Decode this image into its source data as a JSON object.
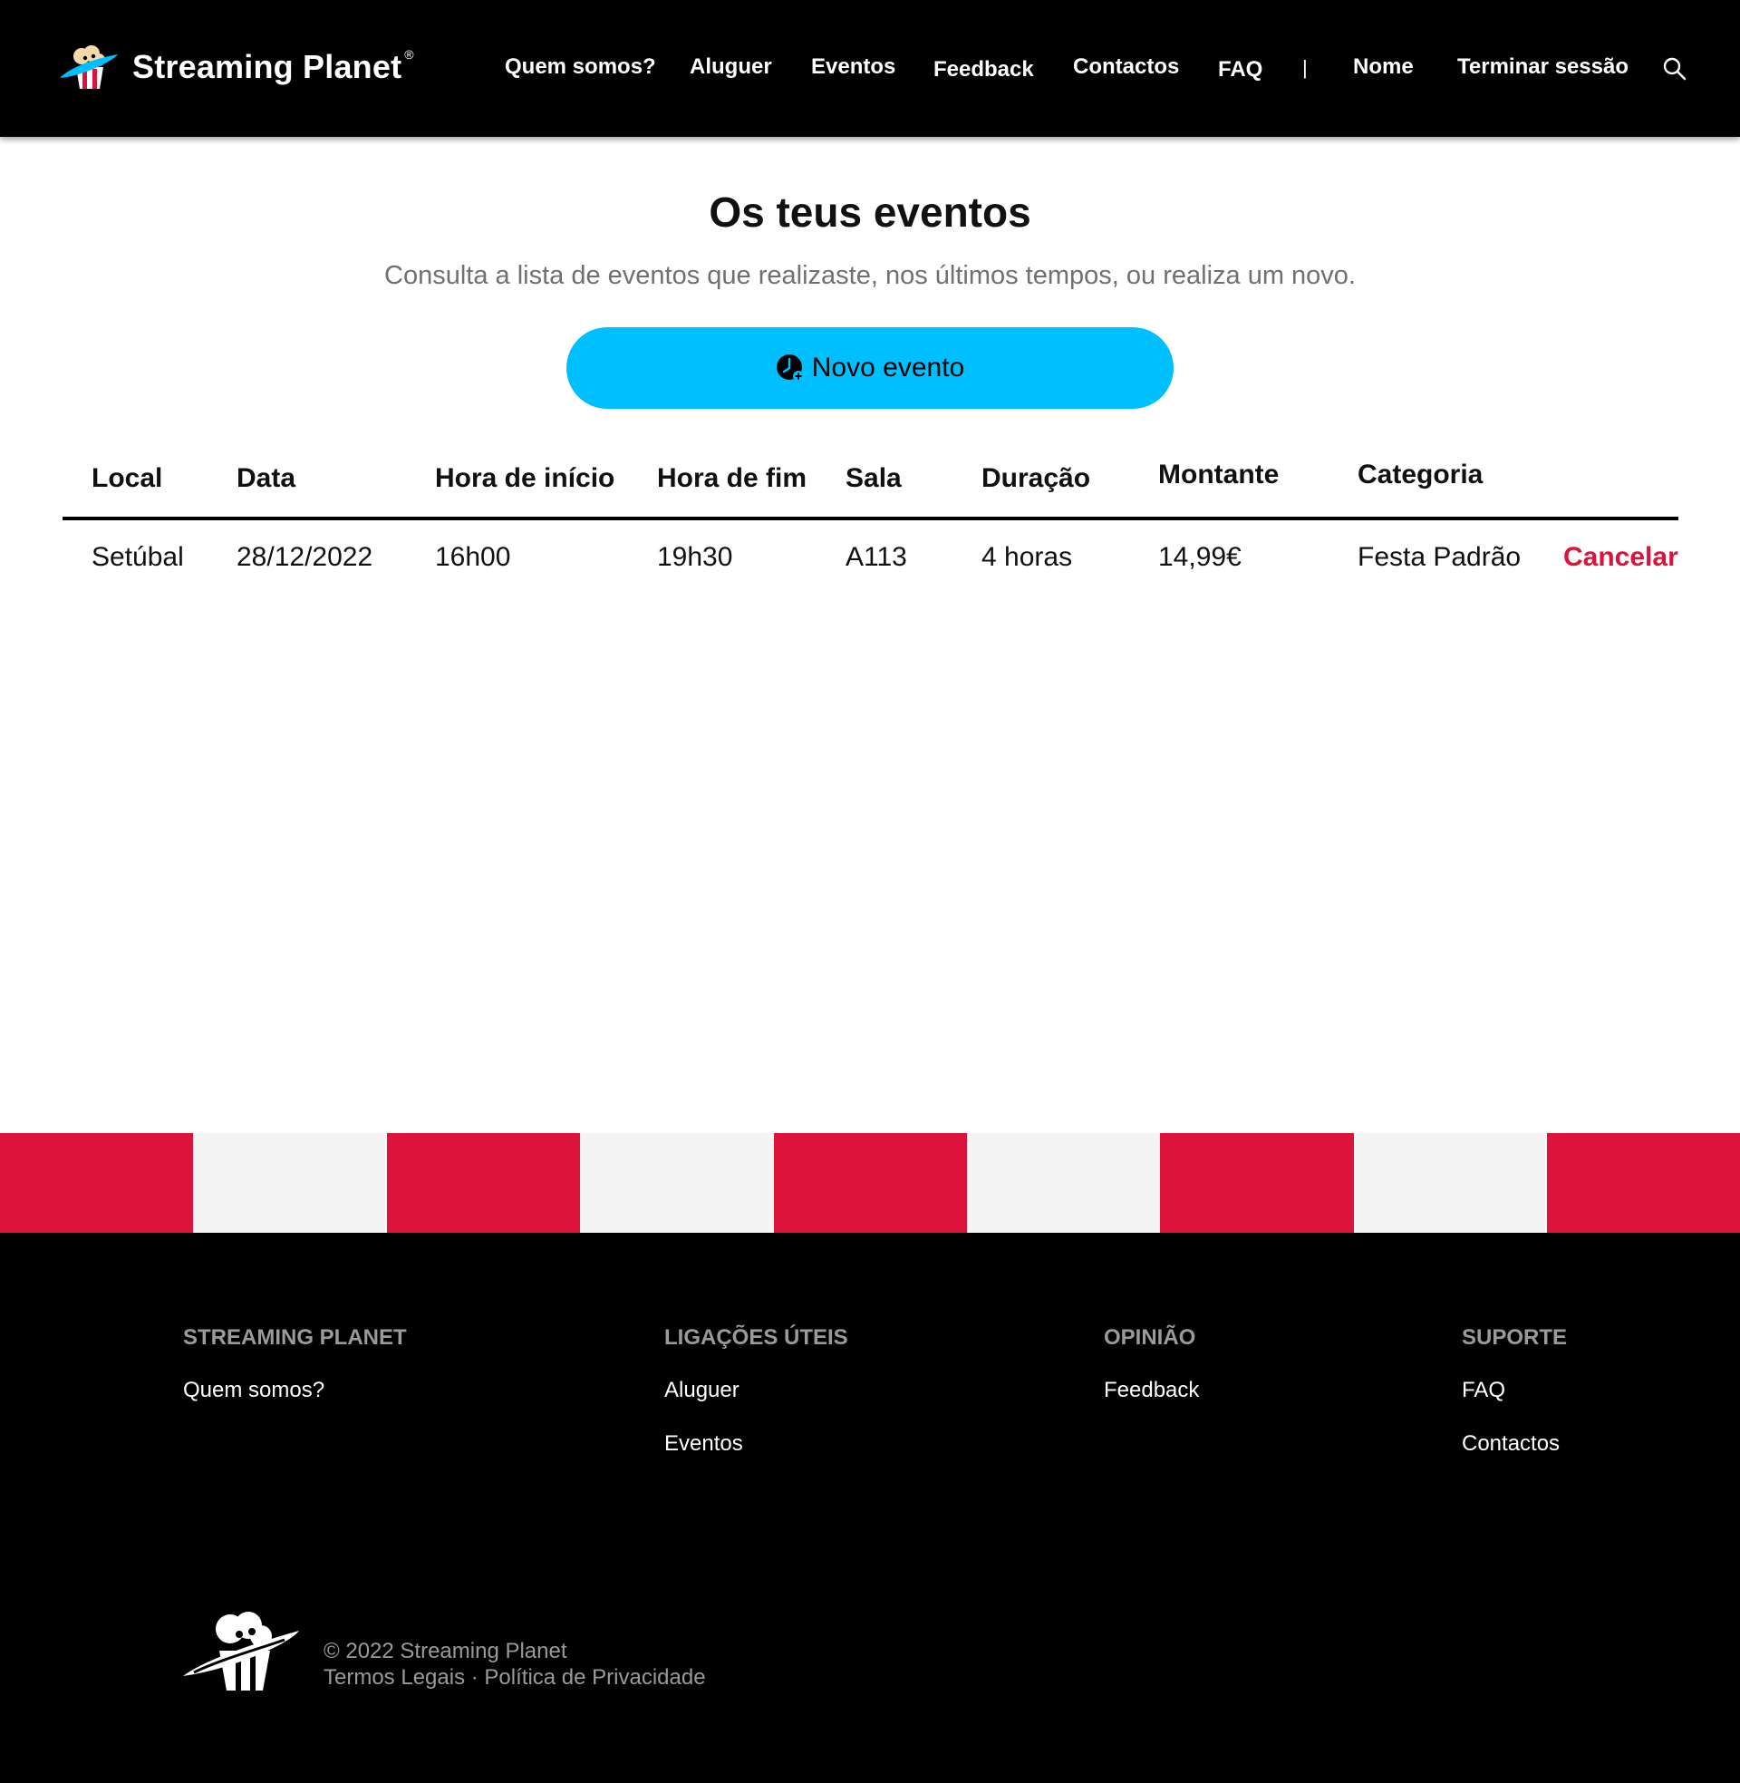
{
  "header": {
    "brand_name": "Streaming Planet",
    "brand_reg": "®",
    "nav": {
      "about": "Quem somos?",
      "rent": "Aluguer",
      "events": "Eventos",
      "feedback": "Feedback",
      "contacts": "Contactos",
      "faq": "FAQ",
      "separator": "|",
      "user": "Nome",
      "logout": "Terminar sessão"
    },
    "icons": {
      "logo": "popcorn-planet-logo",
      "search": "search-icon"
    }
  },
  "main": {
    "title": "Os teus eventos",
    "subtitle": "Consulta a lista de eventos que realizaste, nos últimos tempos, ou realiza um novo.",
    "new_event_button": {
      "label": "Novo evento",
      "icon": "clock-plus-icon",
      "color": "#00bfff"
    },
    "table": {
      "headers": [
        "Local",
        "Data",
        "Hora de início",
        "Hora de fim",
        "Sala",
        "Duração",
        "Montante",
        "Categoria"
      ],
      "rows": [
        {
          "cells": [
            "Setúbal",
            "28/12/2022",
            "16h00",
            "19h30",
            "A113",
            "4 horas",
            "14,99€",
            "Festa Padrão"
          ],
          "action": "Cancelar"
        }
      ]
    }
  },
  "stripes": {
    "colors": [
      "#dc143c",
      "#f4f4f4"
    ]
  },
  "footer": {
    "columns": [
      {
        "heading": "STREAMING PLANET",
        "links": [
          "Quem somos?"
        ]
      },
      {
        "heading": "LIGAÇÕES ÚTEIS",
        "links": [
          "Aluguer",
          "Eventos"
        ]
      },
      {
        "heading": "OPINIÃO",
        "links": [
          "Feedback"
        ]
      },
      {
        "heading": "SUPORTE",
        "links": [
          "FAQ",
          "Contactos"
        ]
      }
    ],
    "copyright": "© 2022 Streaming Planet",
    "legal": {
      "terms": "Termos Legais",
      "separator": "·",
      "privacy": "Política de Privacidade"
    }
  },
  "colors": {
    "accent": "#00bfff",
    "danger": "#dc143c",
    "header_bg": "#000000"
  }
}
